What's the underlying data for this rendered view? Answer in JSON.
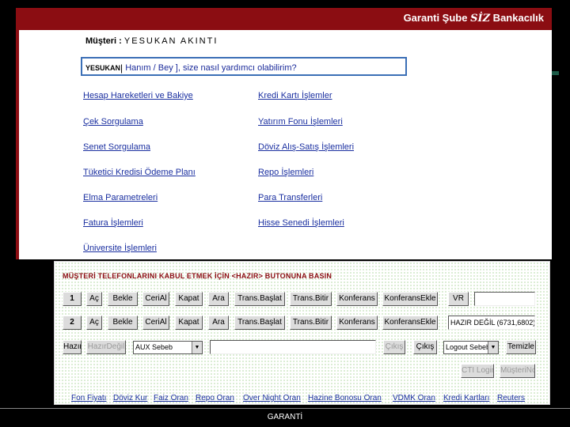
{
  "header": {
    "title_pre": "Garanti Şube ",
    "title_siz": "SİZ",
    "title_post": " Bankacılık"
  },
  "customer": {
    "label": "Müşteri :",
    "name": "YESUKAN AKINTI"
  },
  "greeting": {
    "name": "YESUKAN",
    "text": " Hanım / Bey ], size nasıl yardımcı olabilirim?"
  },
  "menu": {
    "left": [
      "Hesap Hareketleri ve Bakiye",
      "Çek Sorgulama",
      "Senet Sorgulama",
      "Tüketici Kredisi Ödeme Planı",
      "Elma Parametreleri",
      "Fatura İşlemleri",
      "Üniversite İşlemleri"
    ],
    "right": [
      "Kredi Kartı İşlemler",
      "Yatırım Fonu İşlemleri",
      "Döviz Alış-Satış İşlemleri",
      "Repo İşlemleri",
      "Para Transferleri",
      "Hisse Senedi İşlemleri"
    ]
  },
  "phone_panel": {
    "heading": "MÜŞTERİ TELEFONLARINI KABUL ETMEK İÇİN <HAZIR> BUTONUNA BASIN",
    "line1": {
      "number": "1",
      "buttons": [
        "Aç",
        "Bekle",
        "CeriAl",
        "Kapat",
        "Ara",
        "Trans.Başlat",
        "Trans.Bitir",
        "Konferans",
        "KonferansEkle",
        "VR"
      ],
      "field": ""
    },
    "line2": {
      "number": "2",
      "buttons": [
        "Aç",
        "Bekle",
        "CeriAl",
        "Kapat",
        "Ara",
        "Trans.Başlat",
        "Trans.Bitir",
        "Konferans",
        "KonferansEkle"
      ],
      "field": "HAZIR DEĞİL (6731,6802)"
    },
    "row3": {
      "hazir": "Hazır",
      "hazir_degil": "HazırDeğil",
      "aux_select": "AUX Sebeb",
      "cikis_disabled": "Çıkış",
      "cikis": "Çıkış",
      "logout_select": "Logout Sebeb",
      "temizle": "Temizle"
    },
    "row4": {
      "cti_login": "CTI Login",
      "musteri_no": "MüşteriNo"
    }
  },
  "bottom_links": [
    "Fon Fiyatı",
    "Döviz Kur",
    "Faiz Oran",
    "Repo Oran",
    "Over Night Oran",
    "Hazine Bonosu Oran",
    "VDMK Oran",
    "Kredi Kartları",
    "Reuters"
  ],
  "footer": {
    "text": "GARANTİ"
  },
  "colors": {
    "brand_red": "#8b0d12",
    "link_blue": "#1a2fa0",
    "box_border": "#3b6fb6"
  }
}
